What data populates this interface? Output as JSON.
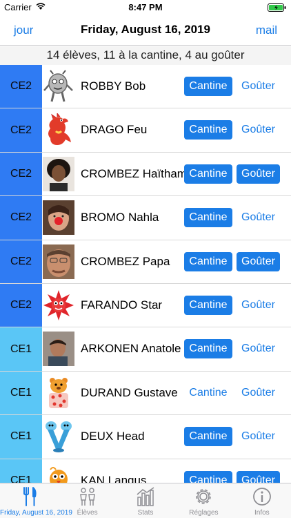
{
  "status": {
    "carrier": "Carrier",
    "time": "8:47 PM"
  },
  "nav": {
    "left": "jour",
    "title": "Friday, August 16, 2019",
    "right": "mail"
  },
  "summary": "14 élèves, 11 à la cantine, 4 au goûter",
  "rows": [
    {
      "level": "CE2",
      "name": "ROBBY Bob",
      "cantine": "Cantine",
      "gouter": "Goûter",
      "cantine_on": true,
      "gouter_on": false,
      "avatar": "robot-icon"
    },
    {
      "level": "CE2",
      "name": "DRAGO Feu",
      "cantine": "Cantine",
      "gouter": "Goûter",
      "cantine_on": true,
      "gouter_on": false,
      "avatar": "dragon-icon"
    },
    {
      "level": "CE2",
      "name": "CROMBEZ Haïtham",
      "cantine": "Cantine",
      "gouter": "Goûter",
      "cantine_on": true,
      "gouter_on": true,
      "avatar": "photo-haitham"
    },
    {
      "level": "CE2",
      "name": "BROMO Nahla",
      "cantine": "Cantine",
      "gouter": "Goûter",
      "cantine_on": true,
      "gouter_on": false,
      "avatar": "photo-nahla"
    },
    {
      "level": "CE2",
      "name": "CROMBEZ Papa",
      "cantine": "Cantine",
      "gouter": "Goûter",
      "cantine_on": true,
      "gouter_on": true,
      "avatar": "photo-papa"
    },
    {
      "level": "CE2",
      "name": "FARANDO Star",
      "cantine": "Cantine",
      "gouter": "Goûter",
      "cantine_on": true,
      "gouter_on": false,
      "avatar": "star-monster-icon"
    },
    {
      "level": "CE1",
      "name": "ARKONEN Anatole",
      "cantine": "Cantine",
      "gouter": "Goûter",
      "cantine_on": true,
      "gouter_on": false,
      "avatar": "photo-anatole"
    },
    {
      "level": "CE1",
      "name": "DURAND Gustave",
      "cantine": "Cantine",
      "gouter": "Goûter",
      "cantine_on": false,
      "gouter_on": false,
      "avatar": "bear-icon"
    },
    {
      "level": "CE1",
      "name": "DEUX Head",
      "cantine": "Cantine",
      "gouter": "Goûter",
      "cantine_on": true,
      "gouter_on": false,
      "avatar": "two-head-icon"
    },
    {
      "level": "CE1",
      "name": "KAN Langus",
      "cantine": "Cantine",
      "gouter": "Goûter",
      "cantine_on": true,
      "gouter_on": true,
      "avatar": "bird-icon"
    }
  ],
  "tabs": [
    {
      "label": "Friday, August 16, 2019",
      "icon": "cutlery-icon",
      "active": true
    },
    {
      "label": "Élèves",
      "icon": "students-icon",
      "active": false
    },
    {
      "label": "Stats",
      "icon": "stats-icon",
      "active": false
    },
    {
      "label": "Réglages",
      "icon": "gear-icon",
      "active": false
    },
    {
      "label": "Infos",
      "icon": "info-icon",
      "active": false
    }
  ],
  "colors": {
    "accent": "#1b7de6",
    "ce2": "#2f7bf3",
    "ce1": "#5ac6f6"
  }
}
